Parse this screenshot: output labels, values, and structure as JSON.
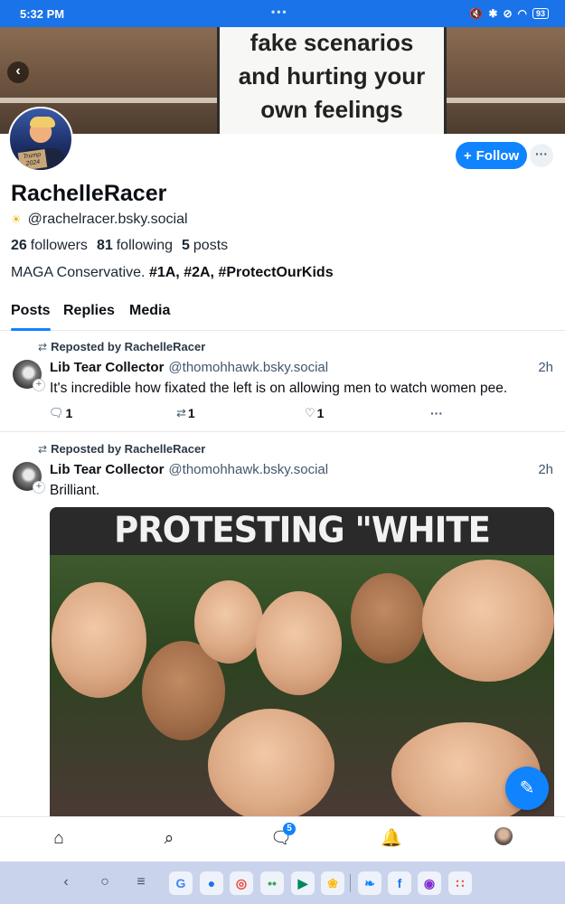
{
  "status_bar": {
    "time": "5:32 PM",
    "dots": "•••",
    "icons": [
      "mute-icon",
      "bluetooth-icon",
      "dnd-icon",
      "wifi-icon"
    ],
    "battery": "93"
  },
  "banner": {
    "sign_lines": [
      "fake scenarios",
      "and hurting your",
      "own feelings"
    ]
  },
  "avatar_card": "Trump 2024",
  "profile": {
    "follow_label": "Follow",
    "follow_icon": "+",
    "more_label": "···",
    "display_name": "RachelleRacer",
    "handle": "@rachelracer.bsky.social",
    "followers_count": "26",
    "followers_label": "followers",
    "following_count": "81",
    "following_label": "following",
    "posts_count": "5",
    "posts_label": "posts",
    "bio_text": "MAGA Conservative.",
    "bio_tags": [
      "#1A,",
      "#2A,",
      "#ProtectOurKids"
    ]
  },
  "tabs": [
    {
      "label": "Posts",
      "active": true
    },
    {
      "label": "Replies",
      "active": false
    },
    {
      "label": "Media",
      "active": false
    }
  ],
  "posts": [
    {
      "repost_label": "Reposted by RachelleRacer",
      "author_name": "Lib Tear Collector",
      "author_handle": "@thomohhawk.bsky.social",
      "time": "2h",
      "text": "It's incredible how fixated the left is on allowing men to watch women pee.",
      "reply_count": "1",
      "repost_count": "1",
      "like_count": "1",
      "more_label": "···"
    },
    {
      "repost_label": "Reposted by RachelleRacer",
      "author_name": "Lib Tear Collector",
      "author_handle": "@thomohhawk.bsky.social",
      "time": "2h",
      "text": "Brilliant.",
      "image_caption": "PROTESTING \"WHITE SUPREMACY\""
    }
  ],
  "bottom_nav": {
    "chat_badge": "5",
    "items": [
      "home-icon",
      "search-icon",
      "chat-icon",
      "notifications-icon",
      "profile-avatar"
    ]
  },
  "taskbar": {
    "apps": [
      {
        "name": "google",
        "glyph": "G",
        "color": "#4285f4"
      },
      {
        "name": "messages",
        "glyph": "●",
        "color": "#1a73e8"
      },
      {
        "name": "chrome",
        "glyph": "◎",
        "color": "#ea4335"
      },
      {
        "name": "assistant",
        "glyph": "••",
        "color": "#34a853"
      },
      {
        "name": "play-store",
        "glyph": "▶",
        "color": "#01875f"
      },
      {
        "name": "photos",
        "glyph": "❀",
        "color": "#fbbc05"
      },
      {
        "name": "bluesky",
        "glyph": "❧",
        "color": "#1083fe"
      },
      {
        "name": "facebook",
        "glyph": "f",
        "color": "#1877f2"
      },
      {
        "name": "podcasts",
        "glyph": "◉",
        "color": "#8430ce"
      },
      {
        "name": "app-drawer",
        "glyph": "∷",
        "color": "#e94235"
      }
    ]
  },
  "colors": {
    "accent": "#1083fe",
    "status_bar": "#1a73e8",
    "taskbar": "#c9d3eb"
  }
}
